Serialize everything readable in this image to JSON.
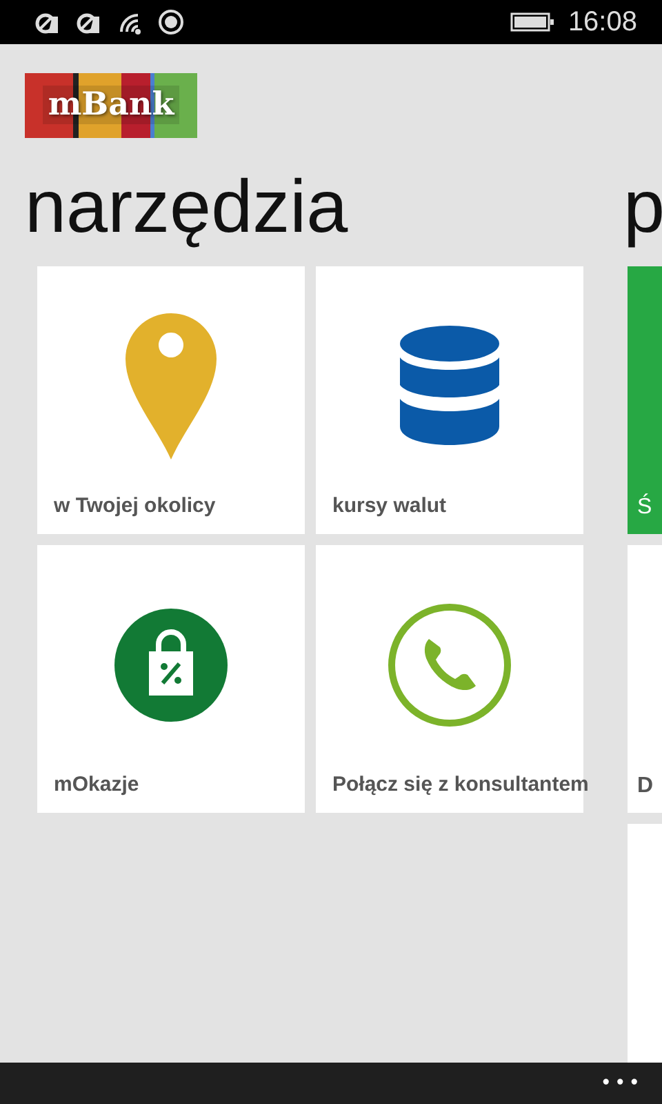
{
  "status_bar": {
    "time": "16:08"
  },
  "logo": {
    "text": "mBank"
  },
  "panels": [
    {
      "title": "narzędzia",
      "tiles": [
        {
          "label": "w Twojej okolicy",
          "kind": "pin"
        },
        {
          "label": "kursy walut",
          "kind": "database"
        },
        {
          "label": "mOkazje",
          "kind": "bag"
        },
        {
          "label": "Połącz się z konsultantem",
          "kind": "phone"
        }
      ]
    },
    {
      "title": "p",
      "tiles": [
        {
          "label": "Ś",
          "color": "#27a844"
        },
        {
          "label": "D",
          "color": "#ffffff"
        },
        {
          "color": "#ffffff"
        }
      ]
    }
  ],
  "app_bar": {
    "more": "•••"
  }
}
